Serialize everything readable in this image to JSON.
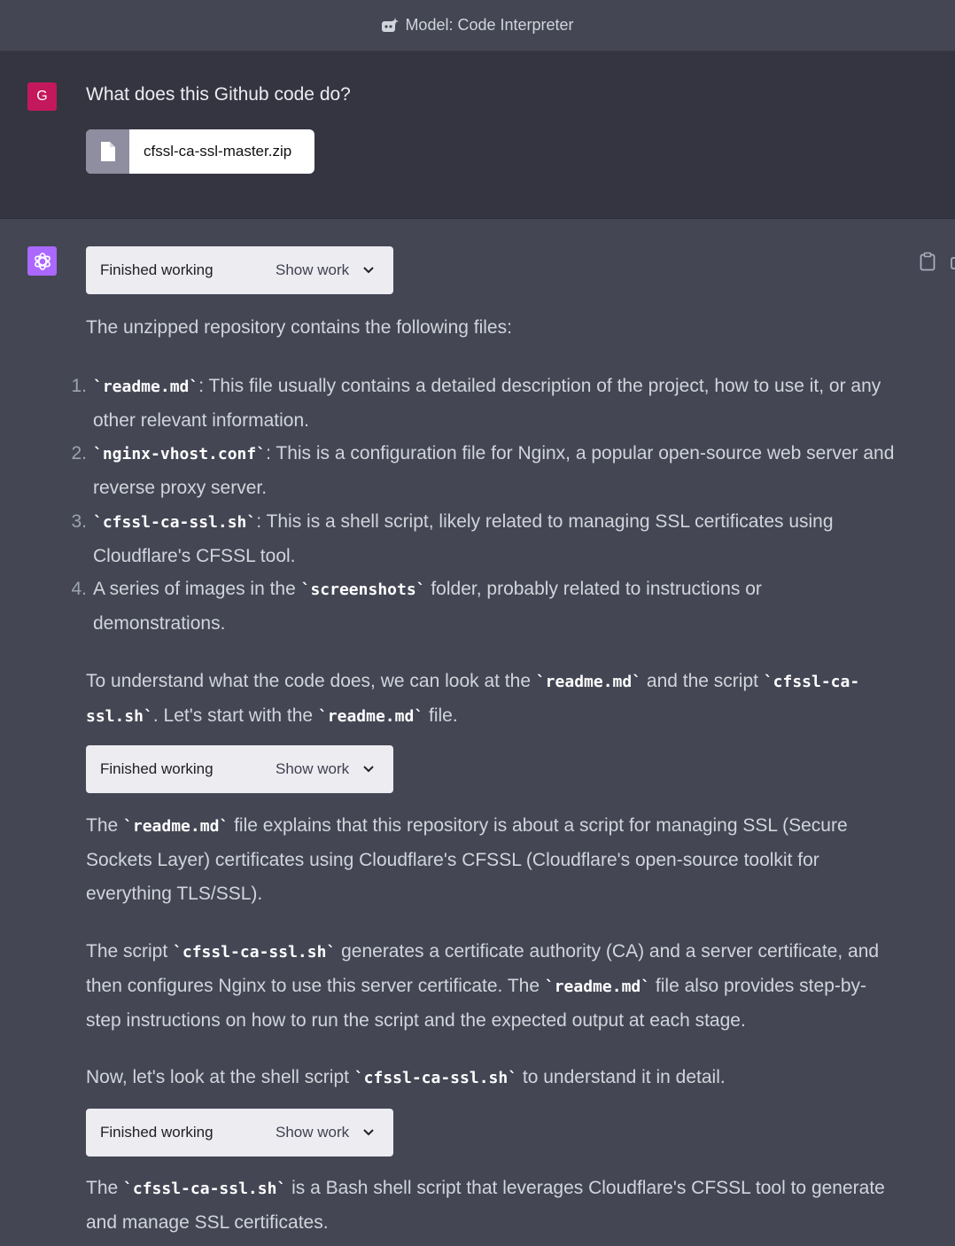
{
  "topbar": {
    "icon": "plugin-sparkle-icon",
    "model_label": "Model: Code Interpreter"
  },
  "user": {
    "avatar_letter": "G",
    "avatar_color": "#c4185c",
    "message": "What does this Github code do?",
    "attachment": {
      "icon": "file-icon",
      "name": "cfssl-ca-ssl-master.zip"
    }
  },
  "assistant": {
    "avatar_icon": "openai-logo-icon",
    "avatar_color": "#ab68ff",
    "copy_icon": "clipboard-icon",
    "work_boxes": [
      {
        "status": "Finished working",
        "toggle": "Show work"
      },
      {
        "status": "Finished working",
        "toggle": "Show work"
      },
      {
        "status": "Finished working",
        "toggle": "Show work"
      }
    ],
    "intro": "The unzipped repository contains the following files:",
    "list": [
      {
        "num": "1.",
        "code": "`readme.md`",
        "text": ": This file usually contains a detailed description of the project, how to use it, or any other relevant information."
      },
      {
        "num": "2.",
        "code": "`nginx-vhost.conf`",
        "text": ": This is a configuration file for Nginx, a popular open-source web server and reverse proxy server."
      },
      {
        "num": "3.",
        "code": "`cfssl-ca-ssl.sh`",
        "text": ": This is a shell script, likely related to managing SSL certificates using Cloudflare's CFSSL tool."
      },
      {
        "num": "4.",
        "pre": "A series of images in the ",
        "code": "`screenshots`",
        "text": " folder, probably related to instructions or demonstrations."
      }
    ],
    "p2": {
      "a": "To understand what the code does, we can look at the ",
      "code1": "`readme.md`",
      "b": " and the script ",
      "code2": "`cfssl-ca-ssl.sh`",
      "c": ". Let's start with the ",
      "code3": "`readme.md`",
      "d": " file."
    },
    "p3": {
      "a": "The ",
      "code1": "`readme.md`",
      "b": " file explains that this repository is about a script for managing SSL (Secure Sockets Layer) certificates using Cloudflare's CFSSL (Cloudflare's open-source toolkit for everything TLS/SSL)."
    },
    "p4": {
      "a": "The script ",
      "code1": "`cfssl-ca-ssl.sh`",
      "b": " generates a certificate authority (CA) and a server certificate, and then configures Nginx to use this server certificate. The ",
      "code2": "`readme.md`",
      "c": " file also provides step-by-step instructions on how to run the script and the expected output at each stage."
    },
    "p5": {
      "a": "Now, let's look at the shell script ",
      "code1": "`cfssl-ca-ssl.sh`",
      "b": " to understand it in detail."
    },
    "p6": {
      "a": "The ",
      "code1": "`cfssl-ca-ssl.sh`",
      "b": " is a Bash shell script that leverages Cloudflare's CFSSL tool to generate and manage SSL certificates."
    }
  }
}
